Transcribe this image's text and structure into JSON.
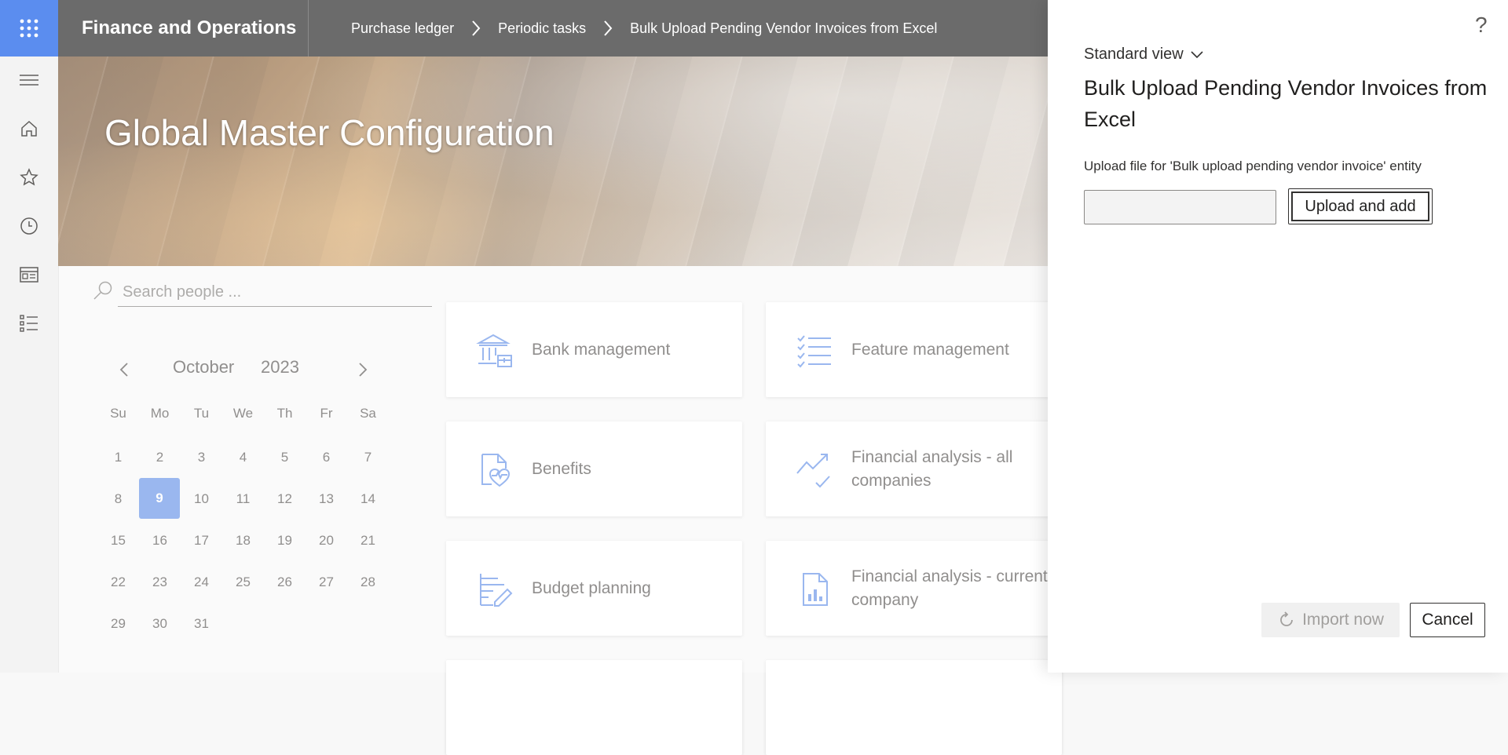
{
  "topbar": {
    "app_title": "Finance and Operations",
    "breadcrumbs": [
      "Purchase ledger",
      "Periodic tasks",
      "Bulk Upload Pending Vendor Invoices from Excel"
    ]
  },
  "workspace": {
    "title": "Global Master Configuration",
    "search": {
      "placeholder": "Search people ...",
      "value": ""
    },
    "calendar": {
      "month": "October",
      "year": "2023",
      "weekdays": [
        "Su",
        "Mo",
        "Tu",
        "We",
        "Th",
        "Fr",
        "Sa"
      ],
      "weeks": [
        [
          "1",
          "2",
          "3",
          "4",
          "5",
          "6",
          "7"
        ],
        [
          "8",
          "9",
          "10",
          "11",
          "12",
          "13",
          "14"
        ],
        [
          "15",
          "16",
          "17",
          "18",
          "19",
          "20",
          "21"
        ],
        [
          "22",
          "23",
          "24",
          "25",
          "26",
          "27",
          "28"
        ],
        [
          "29",
          "30",
          "31",
          "",
          "",
          "",
          ""
        ]
      ],
      "selected_day": "9"
    },
    "tiles": [
      {
        "label": "Bank management",
        "icon": "bank-icon"
      },
      {
        "label": "Feature management",
        "icon": "checklist-icon"
      },
      {
        "label": "Benefits",
        "icon": "benefits-icon"
      },
      {
        "label": "Financial analysis - all companies",
        "icon": "trend-chart-icon"
      },
      {
        "label": "Budget planning",
        "icon": "budget-planning-icon"
      },
      {
        "label": "Financial analysis - current company",
        "icon": "report-icon"
      }
    ]
  },
  "panel": {
    "view": "Standard view",
    "title": "Bulk Upload Pending Vendor Invoices from Excel",
    "upload_label": "Upload file for 'Bulk upload pending vendor invoice' entity",
    "file_value": "",
    "upload_button": "Upload and add",
    "import_button": "Import now",
    "cancel_button": "Cancel",
    "help": "?"
  },
  "colors": {
    "accent": "#5b8def",
    "topbar": "#6b6b6b",
    "icon": "#6f99e8",
    "selected_day": "#6f99e8"
  }
}
